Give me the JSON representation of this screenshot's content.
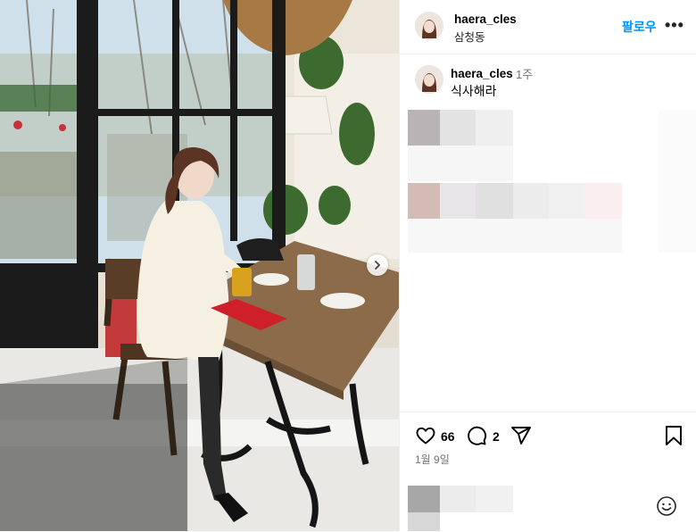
{
  "post": {
    "username": "haera_cles",
    "location": "삼청동",
    "follow_label": "팔로우",
    "more_label": "•••",
    "caption_username": "haera_cles",
    "caption_age": "1주",
    "caption_text": "식사해라",
    "likes": "66",
    "comments": "2",
    "date": "1월 9일"
  },
  "icons": [
    "chevron-right-icon",
    "more-icon",
    "heart-icon",
    "comment-icon",
    "share-icon",
    "bookmark-icon",
    "emoji-icon"
  ],
  "colors": {
    "accent": "#0095f6",
    "secondary_text": "#737373",
    "divider": "#efefef"
  }
}
